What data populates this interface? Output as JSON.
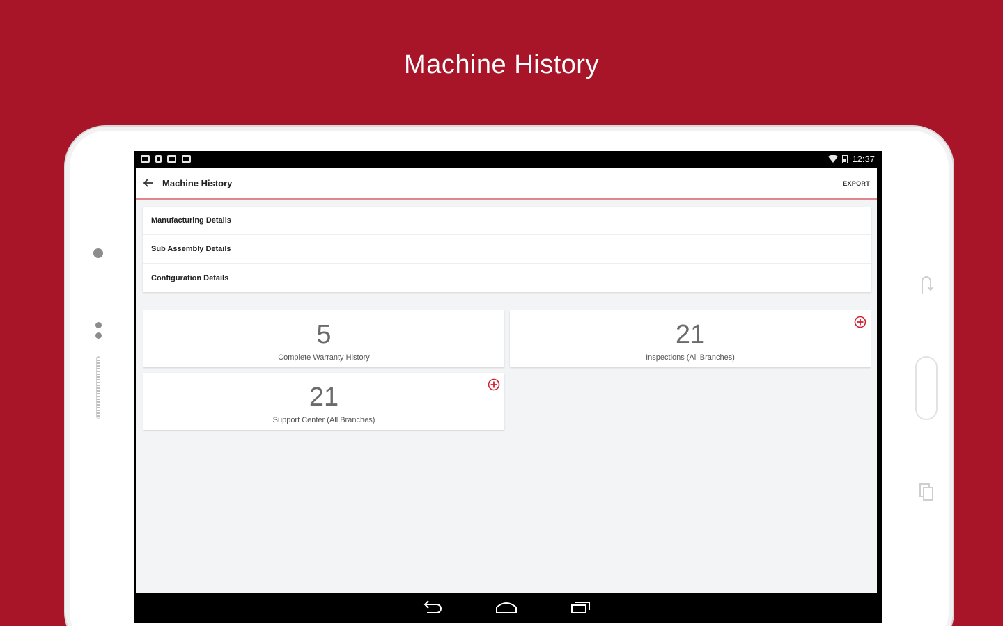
{
  "promo": {
    "title": "Machine History"
  },
  "status_bar": {
    "time": "12:37"
  },
  "toolbar": {
    "title": "Machine History",
    "export_label": "EXPORT"
  },
  "details": [
    {
      "label": "Manufacturing Details"
    },
    {
      "label": "Sub Assembly Details"
    },
    {
      "label": "Configuration Details"
    }
  ],
  "cards": [
    {
      "count": "5",
      "label": "Complete Warranty History",
      "has_add": false
    },
    {
      "count": "21",
      "label": "Inspections (All Branches)",
      "has_add": true
    },
    {
      "count": "21",
      "label": "Support Center (All Branches)",
      "has_add": true
    }
  ],
  "colors": {
    "brand": "#a81428",
    "accent": "#d3202f",
    "divider": "#e0868f"
  },
  "icons": {
    "toolbar_back": "arrow-left-icon",
    "card_add": "plus-circle-icon",
    "nav": [
      "back-icon",
      "home-icon",
      "recents-icon"
    ]
  }
}
